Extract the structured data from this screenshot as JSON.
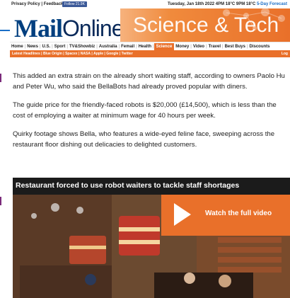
{
  "topbar": {
    "links": "Privacy Policy | Feedback",
    "follow_label": "Follow 21.9K",
    "date_text": "Tuesday, Jan 18th 2022 4PM 18°C 9PM 18°C",
    "forecast_label": "5-Day Forecast"
  },
  "masthead": {
    "logo_mail": "Mail",
    "logo_online": "Online",
    "channel_title": "Science & Tech"
  },
  "nav": {
    "items": [
      "Home",
      "News",
      "U.S.",
      "Sport",
      "TV&Showbiz",
      "Australia",
      "Femail",
      "Health",
      "Science",
      "Money",
      "Video",
      "Travel",
      "Best Buys",
      "Discounts"
    ],
    "active": "Science"
  },
  "subnav": {
    "items": [
      "Latest Headlines",
      "Blue Origin",
      "Spacex",
      "NASA",
      "Apple",
      "Google",
      "Twitter"
    ],
    "login": "Log"
  },
  "article": {
    "paragraphs": [
      "This added an extra strain on the already short waiting staff, according to owners Paolo Hu and Peter Wu, who said the BellaBots had already proved popular with diners.",
      "The guide price for the friendly-faced robots is $20,000 (£14,500), which is less than the cost of employing a waiter at minimum wage for 40 hours per week.",
      "Quirky footage shows Bella, who features a wide-eyed feline face, sweeping across the restaurant floor dishing out delicacies to delighted customers."
    ]
  },
  "video": {
    "title": "Restaurant forced to use robot waiters to tackle staff shortages",
    "watch_label": "Watch the full video"
  },
  "colors": {
    "accent": "#e9702a",
    "brand_blue": "#003f7f",
    "text": "#222222"
  }
}
